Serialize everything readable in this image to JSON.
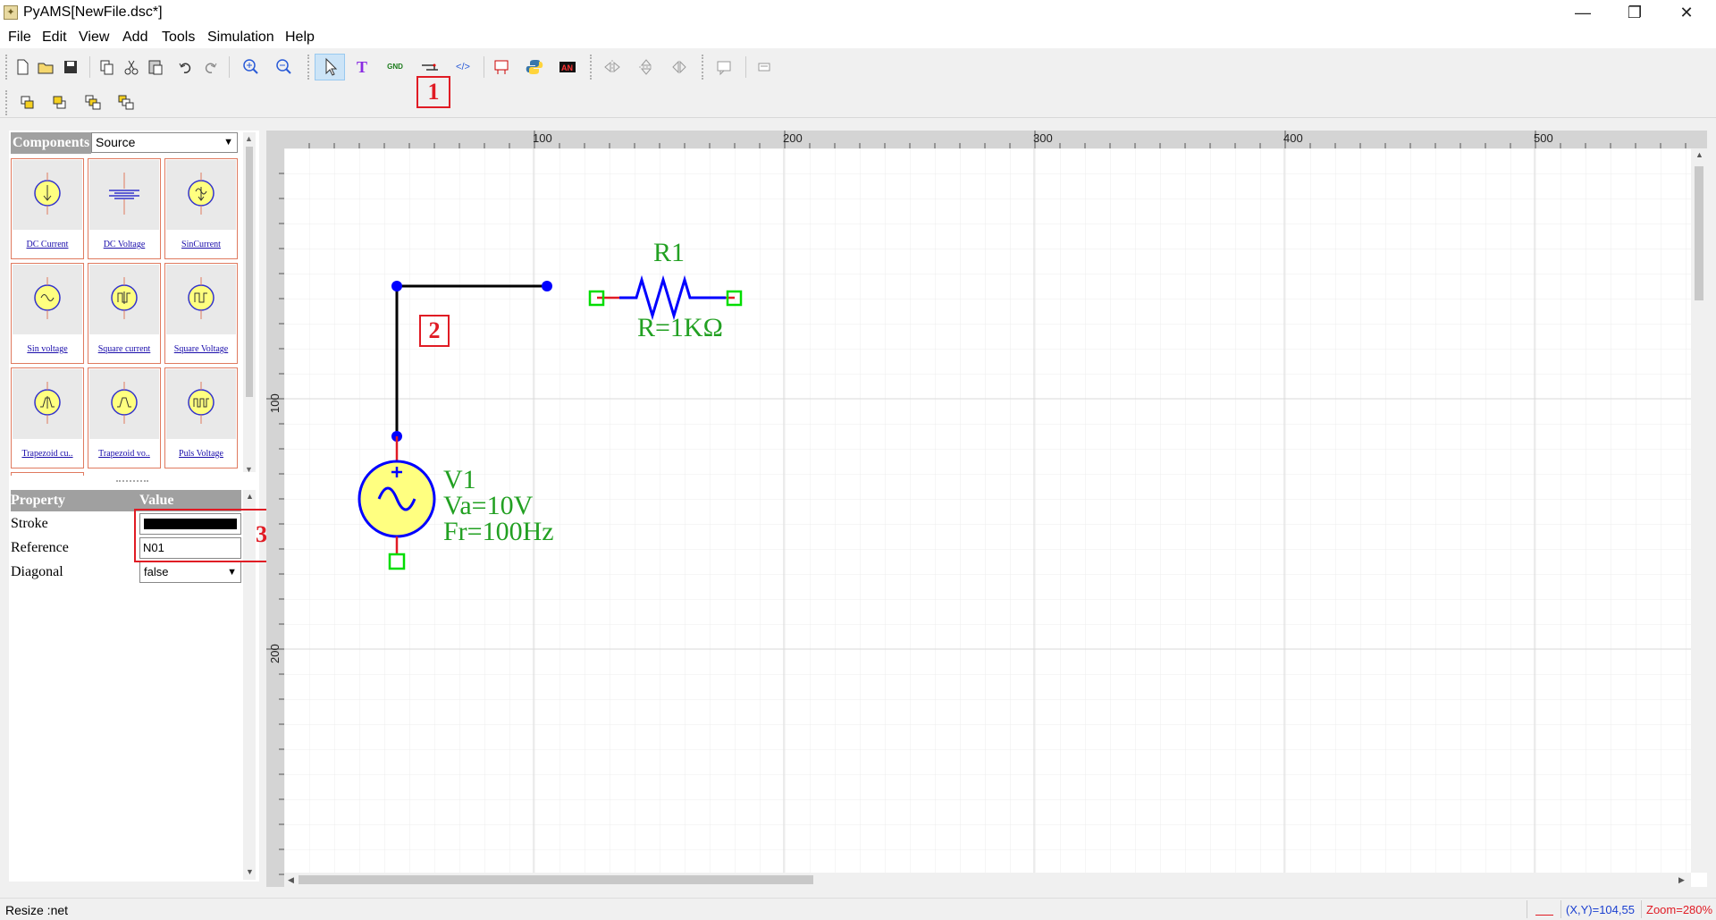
{
  "window": {
    "title": "PyAMS[NewFile.dsc*]",
    "minimize": "—",
    "restore": "❐",
    "close": "✕"
  },
  "menu": [
    "File",
    "Edit",
    "View",
    "Add",
    "Tools",
    "Simulation",
    "Help"
  ],
  "toolbar": {
    "new": "new-file-icon",
    "open": "open-folder-icon",
    "save": "save-icon",
    "copy": "copy-icon",
    "cut": "cut-icon",
    "paste": "paste-icon",
    "undo": "undo-icon",
    "redo": "redo-icon",
    "zoom_in": "zoom-in-icon",
    "zoom_out": "zoom-out-icon",
    "select": "pointer-icon",
    "text": "T",
    "gnd": "GND",
    "wire": "wire-icon",
    "code": "</>",
    "python": "python-icon",
    "analysis": "AN"
  },
  "annotations": [
    "1",
    "2",
    "3"
  ],
  "components": {
    "header": "Components",
    "library": "Source",
    "items": [
      {
        "label": "DC Current",
        "icon": "dc-current-icon"
      },
      {
        "label": "DC Voltage",
        "icon": "dc-voltage-icon"
      },
      {
        "label": "SinCurrent",
        "icon": "sin-current-icon"
      },
      {
        "label": "Sin voltage",
        "icon": "sin-voltage-icon"
      },
      {
        "label": "Square current",
        "icon": "square-current-icon"
      },
      {
        "label": "Square Voltage",
        "icon": "square-voltage-icon"
      },
      {
        "label": "Trapezoid cu..",
        "icon": "trapezoid-current-icon"
      },
      {
        "label": "Trapezoid vo..",
        "icon": "trapezoid-voltage-icon"
      },
      {
        "label": "Puls Voltage",
        "icon": "pulse-voltage-icon"
      }
    ]
  },
  "properties": {
    "header_property": "Property",
    "header_value": "Value",
    "rows": [
      {
        "key": "Stroke",
        "value": "#000000"
      },
      {
        "key": "Reference",
        "value": "N01"
      },
      {
        "key": "Diagonal",
        "value": "false"
      }
    ]
  },
  "ruler": {
    "top": [
      "100",
      "200",
      "300",
      "400",
      "500"
    ],
    "left": [
      "100",
      "200"
    ]
  },
  "schematic": {
    "resistor": {
      "ref": "R1",
      "value": "R=1KΩ"
    },
    "source": {
      "ref": "V1",
      "amp": "Va=10V",
      "freq": "Fr=100Hz"
    },
    "colors": {
      "wire": "#000000",
      "node": "#0000ff",
      "label": "#22a022",
      "pin": "#00dd00",
      "lead": "#e01b24",
      "source_fill": "#ffff80"
    }
  },
  "status": {
    "message": "Resize :net",
    "xy": "(X,Y)=104,55",
    "zoom": "Zoom=280%"
  }
}
